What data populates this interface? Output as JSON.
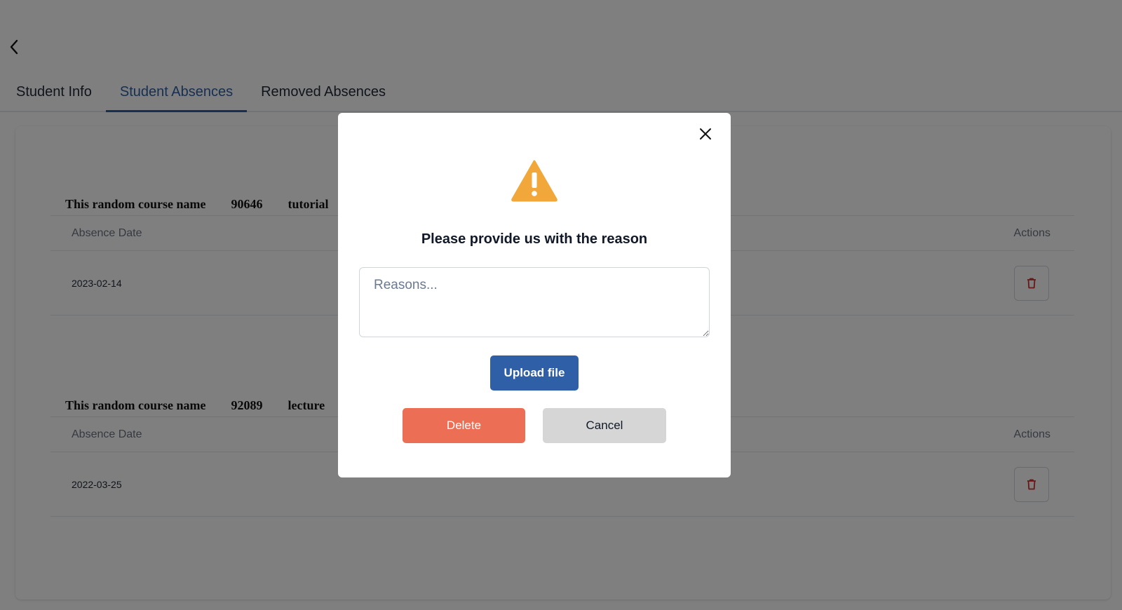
{
  "tabs": [
    {
      "label": "Student Info"
    },
    {
      "label": "Student Absences"
    },
    {
      "label": "Removed Absences"
    }
  ],
  "active_tab": "Student Absences",
  "columns": {
    "absence_date": "Absence Date",
    "actions": "Actions"
  },
  "courses": [
    {
      "name": "This random course name",
      "code": "90646",
      "type": "tutorial",
      "absences": [
        {
          "date": "2023-02-14"
        }
      ]
    },
    {
      "name": "This random course name",
      "code": "92089",
      "type": "lecture",
      "absences": [
        {
          "date": "2022-03-25"
        }
      ]
    }
  ],
  "modal": {
    "title": "Please provide us with the reason",
    "reason_placeholder": "Reasons...",
    "upload_label": "Upload file",
    "delete_label": "Delete",
    "cancel_label": "Cancel"
  },
  "colors": {
    "primary": "#2f5fa7",
    "danger": "#ec6e54",
    "warning": "#f2a73b",
    "trash": "#d32f2f",
    "cancel_bg": "#d6d6d6"
  },
  "icons": {
    "back": "chevron-left-icon",
    "close": "close-icon",
    "warning": "warning-triangle-icon",
    "delete_row": "trash-icon"
  }
}
